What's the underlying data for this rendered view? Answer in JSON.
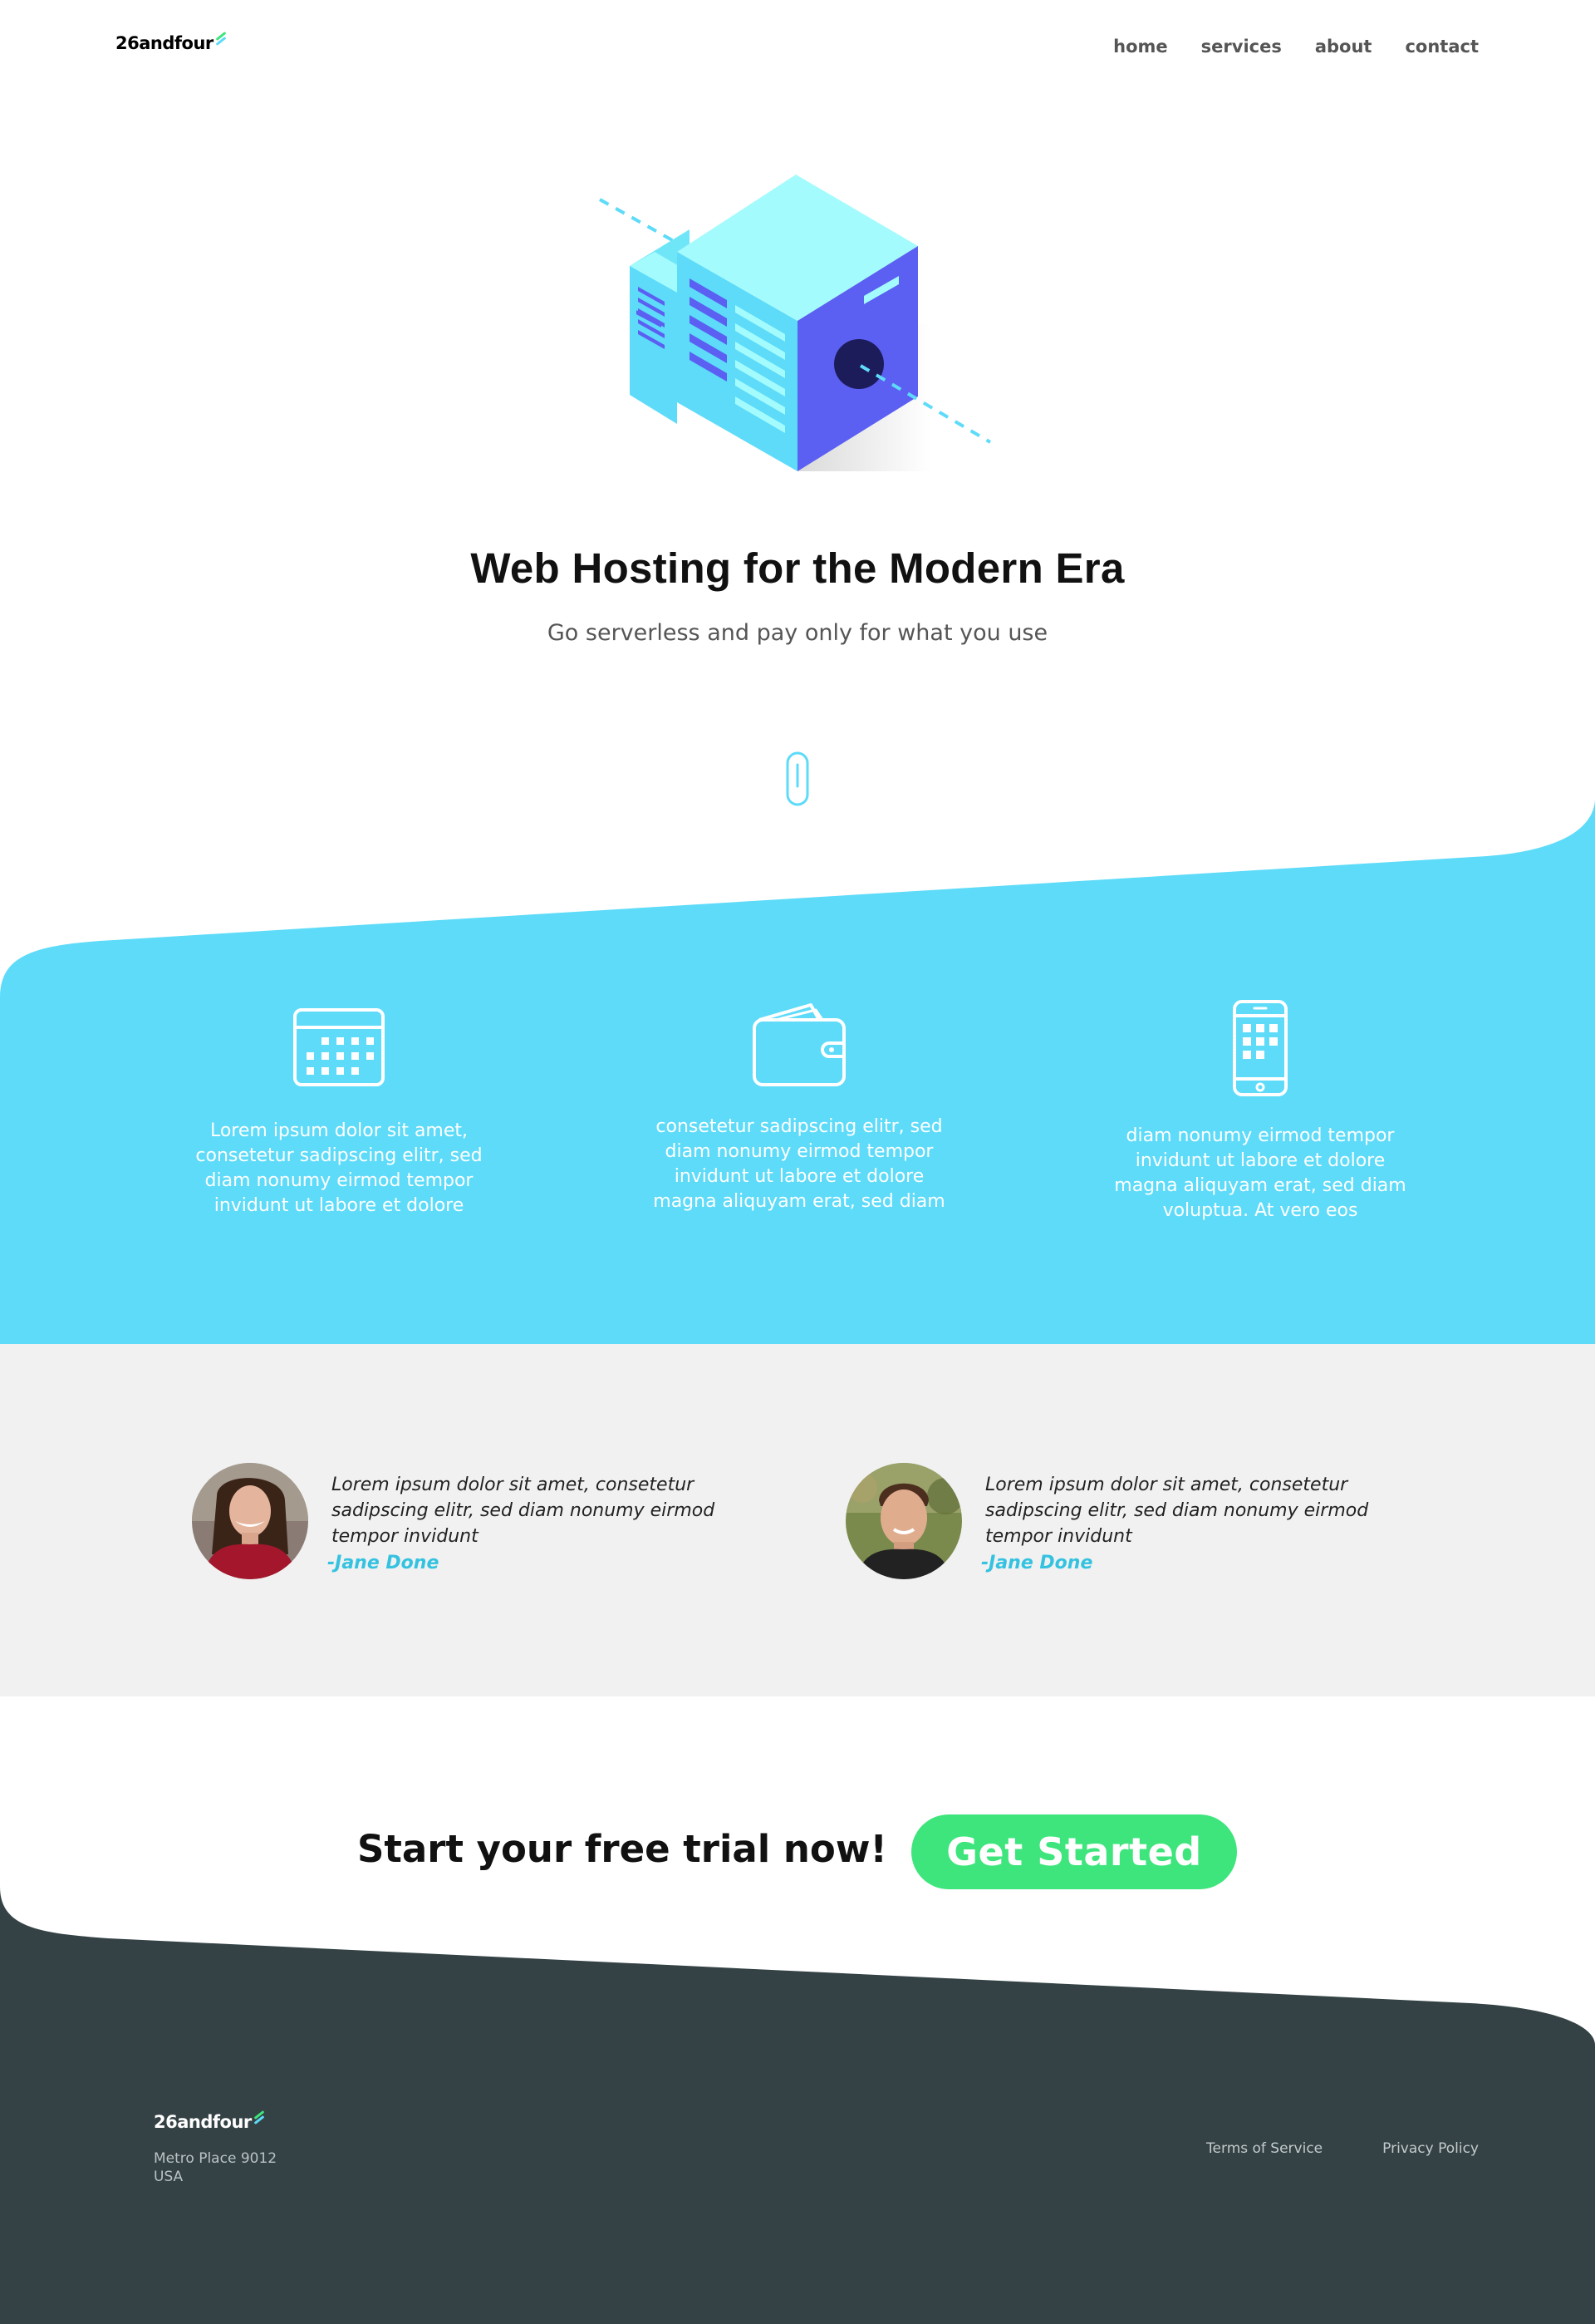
{
  "nav": {
    "logo": "26andfour",
    "links": [
      "home",
      "services",
      "about",
      "contact"
    ]
  },
  "hero": {
    "title": "Web Hosting for the Modern Era",
    "subtitle": "Go serverless and pay only for what you use"
  },
  "features": [
    {
      "icon": "calendar-icon",
      "text": "Lorem ipsum dolor sit amet, consetetur sadipscing elitr, sed diam nonumy eirmod tempor invidunt ut labore et dolore"
    },
    {
      "icon": "wallet-icon",
      "text": "consetetur sadipscing elitr, sed diam nonumy eirmod tempor invidunt ut labore et dolore magna aliquyam erat, sed diam"
    },
    {
      "icon": "smartphone-icon",
      "text": "diam nonumy eirmod tempor invidunt ut labore et dolore magna aliquyam erat, sed diam voluptua. At vero eos"
    }
  ],
  "testimonials": [
    {
      "quote": "Lorem ipsum dolor sit amet, consetetur sadipscing elitr, sed diam nonumy eirmod tempor invidunt",
      "author": "-Jane Done"
    },
    {
      "quote": "Lorem ipsum dolor sit amet, consetetur sadipscing elitr, sed diam nonumy eirmod tempor invidunt",
      "author": "-Jane Done"
    }
  ],
  "cta": {
    "text": "Start your free trial now!",
    "button": "Get Started"
  },
  "footer": {
    "logo": "26andfour",
    "address_line1": "Metro Place 9012",
    "address_line2": "USA",
    "links": [
      "Terms of Service",
      "Privacy Policy"
    ]
  },
  "colors": {
    "accent_blue": "#5ddbf9",
    "accent_green": "#3ee57c",
    "testimonial_bg": "#f1f1f1",
    "footer_bg": "#344245"
  }
}
